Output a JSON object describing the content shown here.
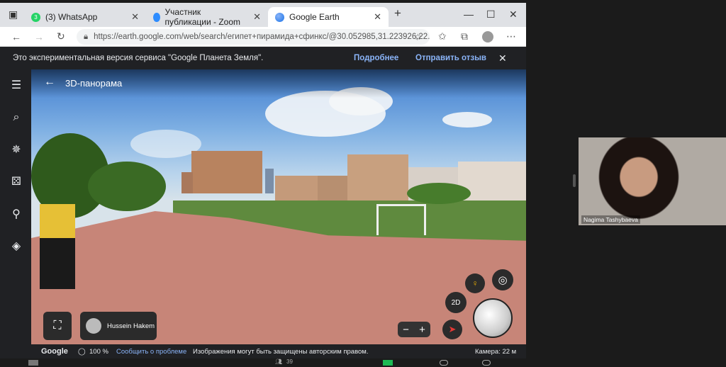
{
  "browser": {
    "tabs": [
      {
        "label": "(3) WhatsApp",
        "badge": "3"
      },
      {
        "label": "Участник публикации - Zoom"
      },
      {
        "label": "Google Earth"
      }
    ],
    "url": "https://earth.google.com/web/search/египет+пирамида+сфинкс/@30.052985,31.223926,22.392..."
  },
  "banner": {
    "text": "Это экспериментальная версия сервиса \"Google Планета Земля\".",
    "more": "Подробнее",
    "feedback": "Отправить отзыв"
  },
  "viewer": {
    "title": "3D-панорама",
    "btn_2d": "2D",
    "author": "Hussein Hakem"
  },
  "footer": {
    "brand": "Google",
    "zoom": "100 %",
    "report": "Сообщить о проблеме",
    "copyright": "Изображения могут быть защищены авторским правом.",
    "camera": "Камера: 22 м"
  },
  "participant": {
    "name": "Nagima Tashybaeva"
  },
  "zoom_toolbar": {
    "participants_count": "39"
  }
}
